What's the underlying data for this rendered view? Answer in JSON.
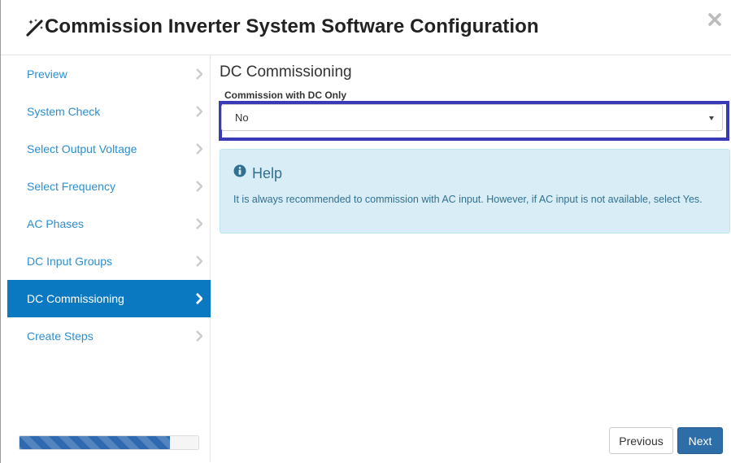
{
  "header": {
    "title": "Commission Inverter System Software Configuration",
    "icon": "magic-wand-icon",
    "close_icon": "close-icon"
  },
  "sidebar": {
    "items": [
      {
        "label": "Preview",
        "active": false
      },
      {
        "label": "System Check",
        "active": false
      },
      {
        "label": "Select Output Voltage",
        "active": false
      },
      {
        "label": "Select Frequency",
        "active": false
      },
      {
        "label": "AC Phases",
        "active": false
      },
      {
        "label": "DC Input Groups",
        "active": false
      },
      {
        "label": "DC Commissioning",
        "active": true
      },
      {
        "label": "Create Steps",
        "active": false
      }
    ],
    "progress": 0.84
  },
  "main": {
    "title": "DC Commissioning",
    "field_label": "Commission with DC Only",
    "select_value": "No",
    "help": {
      "title": "Help",
      "icon": "info-circle-icon",
      "text": "It is always recommended to commission with AC input. However, if AC input is not available, select Yes."
    }
  },
  "footer": {
    "previous_label": "Previous",
    "next_label": "Next"
  },
  "colors": {
    "active_nav": "#0b79c2",
    "link": "#2a8fd0",
    "highlight_border": "#3a3ab8",
    "help_bg": "#d9edf7",
    "help_text": "#31708f",
    "next_button": "#2e6ea8",
    "progress": "#2f6ab0"
  }
}
